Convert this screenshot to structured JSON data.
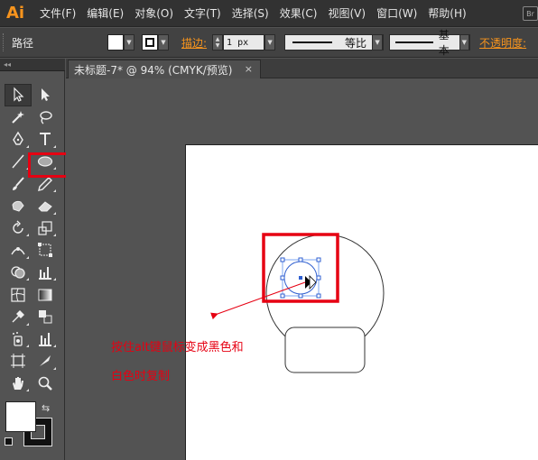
{
  "app": {
    "logo": "Ai",
    "menu": [
      "文件(F)",
      "编辑(E)",
      "对象(O)",
      "文字(T)",
      "选择(S)",
      "效果(C)",
      "视图(V)",
      "窗口(W)",
      "帮助(H)"
    ],
    "bridge_label": "Br"
  },
  "control": {
    "selection_label": "路径",
    "stroke_label": "描边:",
    "stroke_weight": "1 px",
    "profile_label": "等比",
    "brush_label": "基本",
    "opacity_label": "不透明度:"
  },
  "toolbox": {
    "collapse_label": "◂◂",
    "selected_tool": "ellipse-tool",
    "highlight_color": "#e60012"
  },
  "document": {
    "tab_title": "未标题-7* @ 94% (CMYK/预览)",
    "close_glyph": "×"
  },
  "annotation": {
    "line1": "按住alt键鼠标变成黑色和",
    "line2": "白色时复制",
    "color": "#e60012"
  }
}
